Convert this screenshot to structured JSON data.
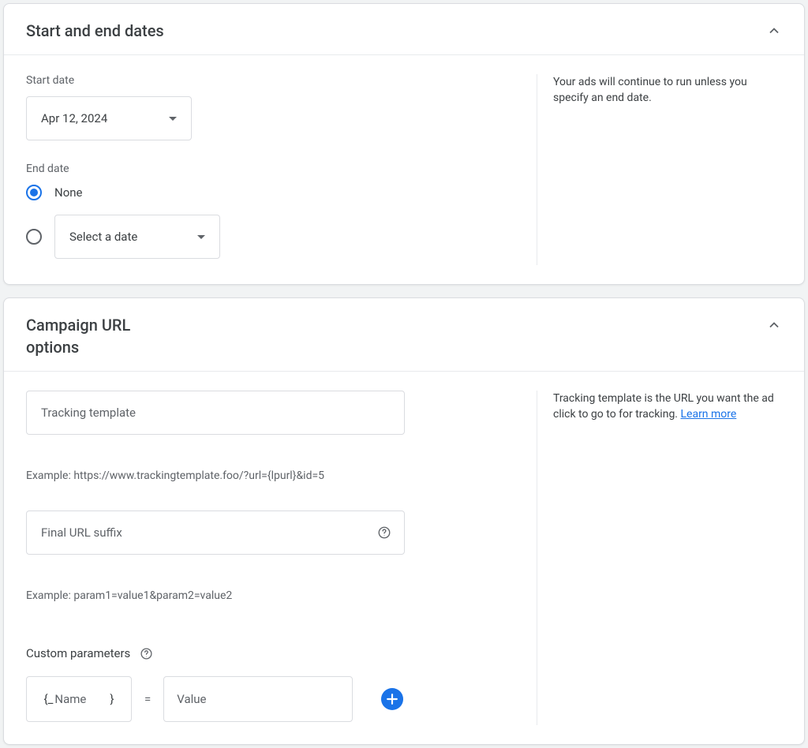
{
  "dates_card": {
    "title": "Start and end dates",
    "start_label": "Start date",
    "start_value": "Apr 12, 2024",
    "end_label": "End date",
    "end_none_label": "None",
    "end_select_placeholder": "Select a date",
    "help_text": "Your ads will continue to run unless you specify an end date."
  },
  "url_card": {
    "title": "Campaign URL options",
    "tracking_placeholder": "Tracking template",
    "tracking_example": "Example: https://www.trackingtemplate.foo/?url={lpurl}&id=5",
    "suffix_placeholder": "Final URL suffix",
    "suffix_example": "Example: param1=value1&param2=value2",
    "custom_params_label": "Custom parameters",
    "param_name_prefix": "{_",
    "param_name_placeholder": "Name",
    "param_name_suffix": "}",
    "equals": "=",
    "param_value_placeholder": "Value",
    "help_text": "Tracking template is the URL you want the ad click to go to for tracking.",
    "help_link": "Learn more"
  }
}
